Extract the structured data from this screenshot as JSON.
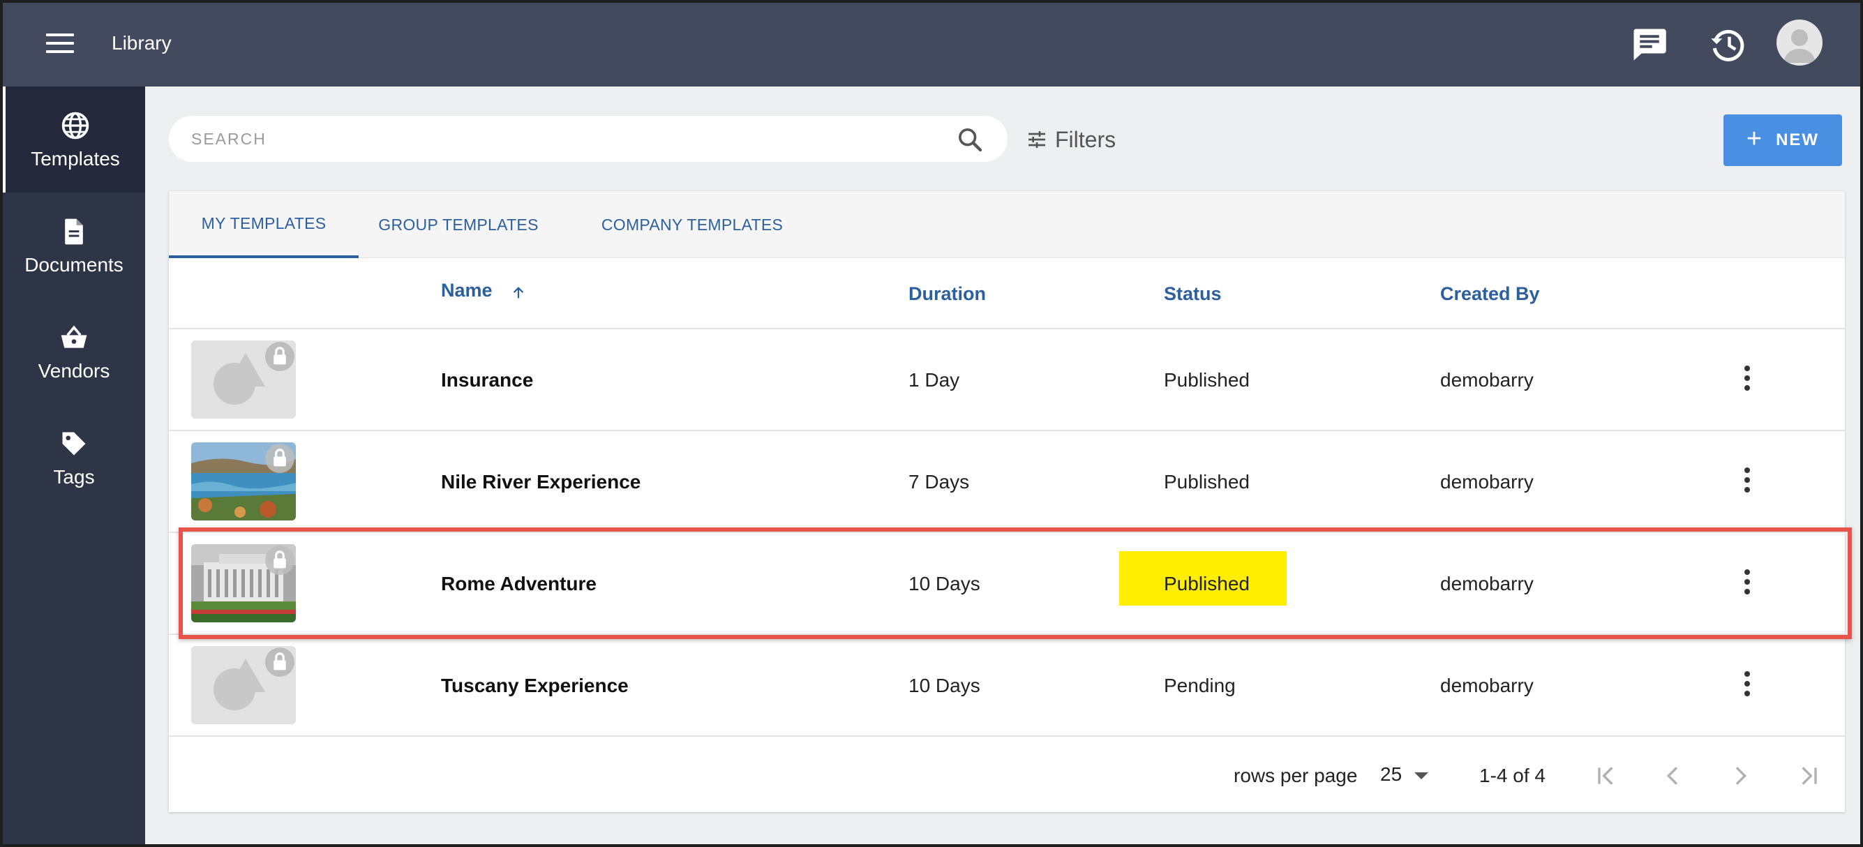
{
  "header": {
    "title": "Library"
  },
  "sidebar": {
    "items": [
      {
        "label": "Templates",
        "icon": "globe-icon",
        "active": true
      },
      {
        "label": "Documents",
        "icon": "document-icon",
        "active": false
      },
      {
        "label": "Vendors",
        "icon": "basket-icon",
        "active": false
      },
      {
        "label": "Tags",
        "icon": "tag-icon",
        "active": false
      }
    ]
  },
  "toolbar": {
    "search_placeholder": "SEARCH",
    "filters_label": "Filters",
    "new_label": "NEW"
  },
  "tabs": [
    {
      "label": "MY TEMPLATES",
      "active": true
    },
    {
      "label": "GROUP TEMPLATES",
      "active": false
    },
    {
      "label": "COMPANY TEMPLATES",
      "active": false
    }
  ],
  "table": {
    "columns": {
      "name": "Name",
      "duration": "Duration",
      "status": "Status",
      "created_by": "Created By"
    },
    "rows": [
      {
        "name": "Insurance",
        "duration": "1 Day",
        "status": "Published",
        "created_by": "demobarry",
        "thumbnail": "placeholder-image"
      },
      {
        "name": "Nile River Experience",
        "duration": "7 Days",
        "status": "Published",
        "created_by": "demobarry",
        "thumbnail": "river-photo"
      },
      {
        "name": "Rome Adventure",
        "duration": "10 Days",
        "status": "Published",
        "created_by": "demobarry",
        "thumbnail": "rome-monument-photo"
      },
      {
        "name": "Tuscany Experience",
        "duration": "10 Days",
        "status": "Pending",
        "created_by": "demobarry",
        "thumbnail": "placeholder-image"
      }
    ]
  },
  "pagination": {
    "rows_per_page_label": "rows per page",
    "rows_per_page": "25",
    "range": "1-4 of 4"
  },
  "colors": {
    "topbar": "#434a5e",
    "sidebar": "#2e3546",
    "accent": "#2c5f9e",
    "new_button": "#4a90e2",
    "status_highlight": "#ffee00",
    "row_highlight_border": "#e8534a"
  }
}
